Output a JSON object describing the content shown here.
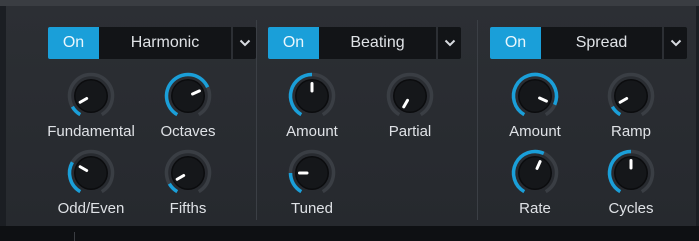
{
  "colors": {
    "accent": "#1a9fd9",
    "track": "#3a3e44",
    "knob_body": "#15171a",
    "indicator": "#ffffff"
  },
  "harmonic": {
    "on_label": "On",
    "mode": "Harmonic",
    "menu_icon": "chevron-down-icon",
    "knobs": [
      {
        "label": "Fundamental",
        "value": 0.1
      },
      {
        "label": "Octaves",
        "value": 0.72
      },
      {
        "label": "Odd/Even",
        "value": 0.3
      },
      {
        "label": "Fifths",
        "value": 0.1
      }
    ]
  },
  "beating": {
    "on_label": "On",
    "mode": "Beating",
    "menu_icon": "chevron-down-icon",
    "knobs": [
      {
        "label": "Amount",
        "value": 0.5
      },
      {
        "label": "Partial",
        "value": 0.0
      },
      {
        "label": "Tuned",
        "value": 0.2
      }
    ]
  },
  "spread": {
    "on_label": "On",
    "mode": "Spread",
    "menu_icon": "chevron-down-icon",
    "knobs": [
      {
        "label": "Amount",
        "value": 0.88
      },
      {
        "label": "Ramp",
        "value": 0.1
      },
      {
        "label": "Rate",
        "value": 0.58
      },
      {
        "label": "Cycles",
        "value": 0.5
      }
    ]
  }
}
